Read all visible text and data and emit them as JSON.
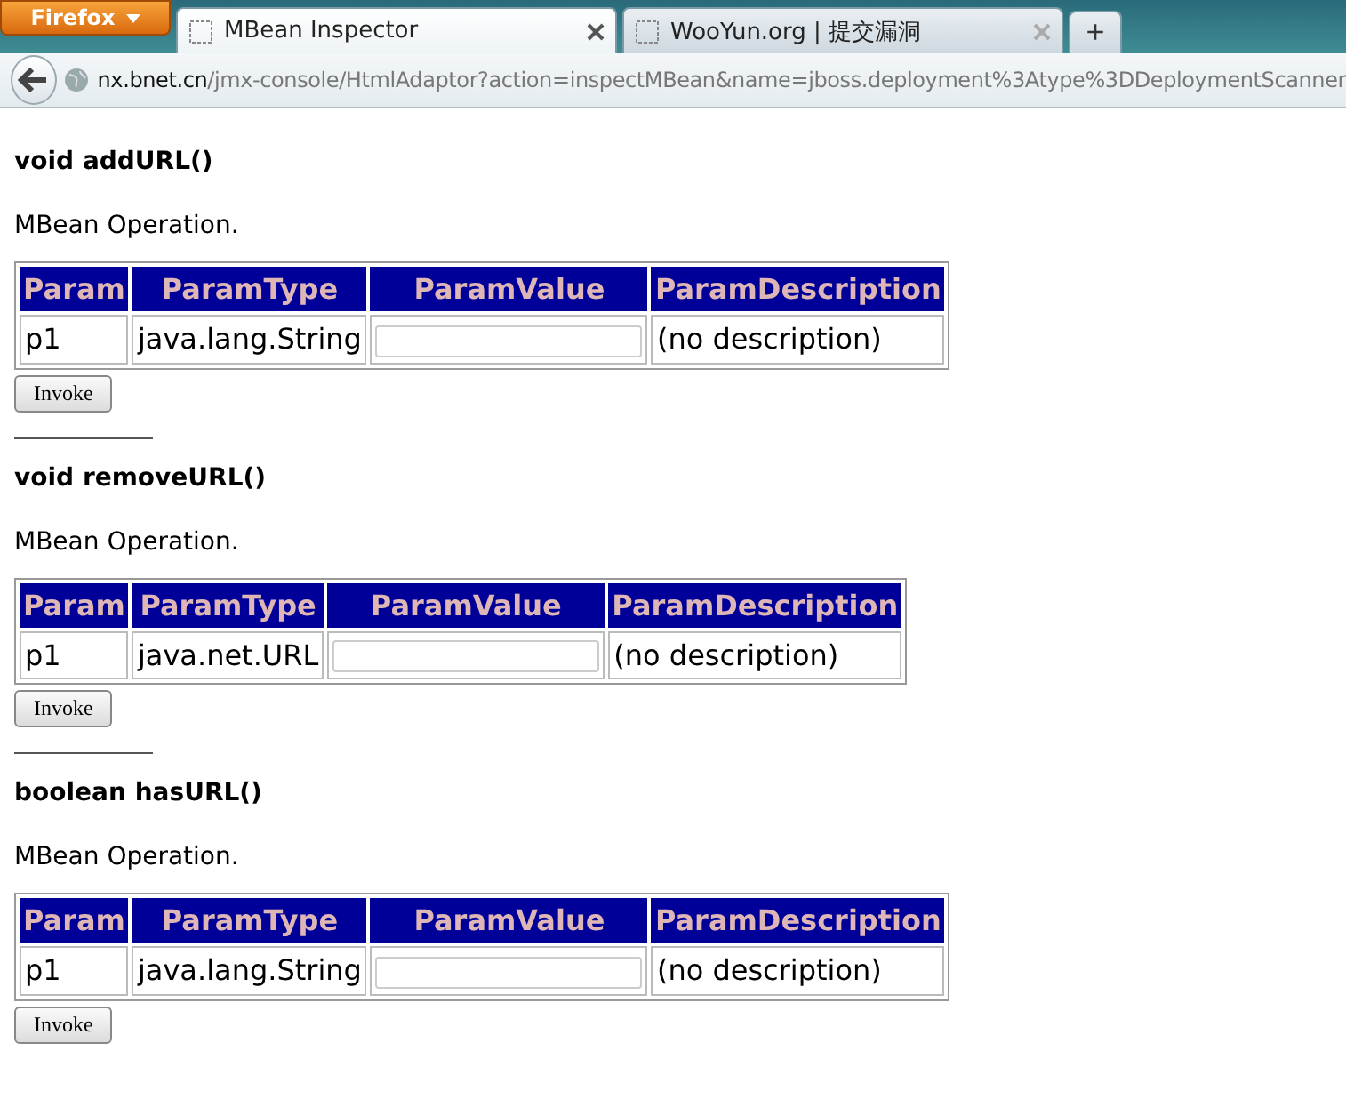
{
  "browser": {
    "menu_button": "Firefox",
    "tabs": [
      {
        "title": "MBean Inspector",
        "selected": true
      },
      {
        "title": "WooYun.org | 提交漏洞",
        "selected": false
      }
    ],
    "new_tab": "+",
    "url_host": "nx.bnet.cn",
    "url_path": "/jmx-console/HtmlAdaptor?action=inspectMBean&name=jboss.deployment%3Atype%3DDeploymentScanner"
  },
  "operations": [
    {
      "signature": "void addURL()",
      "description": "MBean Operation.",
      "columns": [
        "Param",
        "ParamType",
        "ParamValue",
        "ParamDescription"
      ],
      "params": [
        {
          "name": "p1",
          "type": "java.lang.String",
          "description": "(no description)"
        }
      ],
      "button": "Invoke"
    },
    {
      "signature": "void removeURL()",
      "description": "MBean Operation.",
      "columns": [
        "Param",
        "ParamType",
        "ParamValue",
        "ParamDescription"
      ],
      "params": [
        {
          "name": "p1",
          "type": "java.net.URL",
          "description": "(no description)"
        }
      ],
      "button": "Invoke"
    },
    {
      "signature": "boolean hasURL()",
      "description": "MBean Operation.",
      "columns": [
        "Param",
        "ParamType",
        "ParamValue",
        "ParamDescription"
      ],
      "params": [
        {
          "name": "p1",
          "type": "java.lang.String",
          "description": "(no description)"
        }
      ],
      "button": "Invoke"
    }
  ]
}
